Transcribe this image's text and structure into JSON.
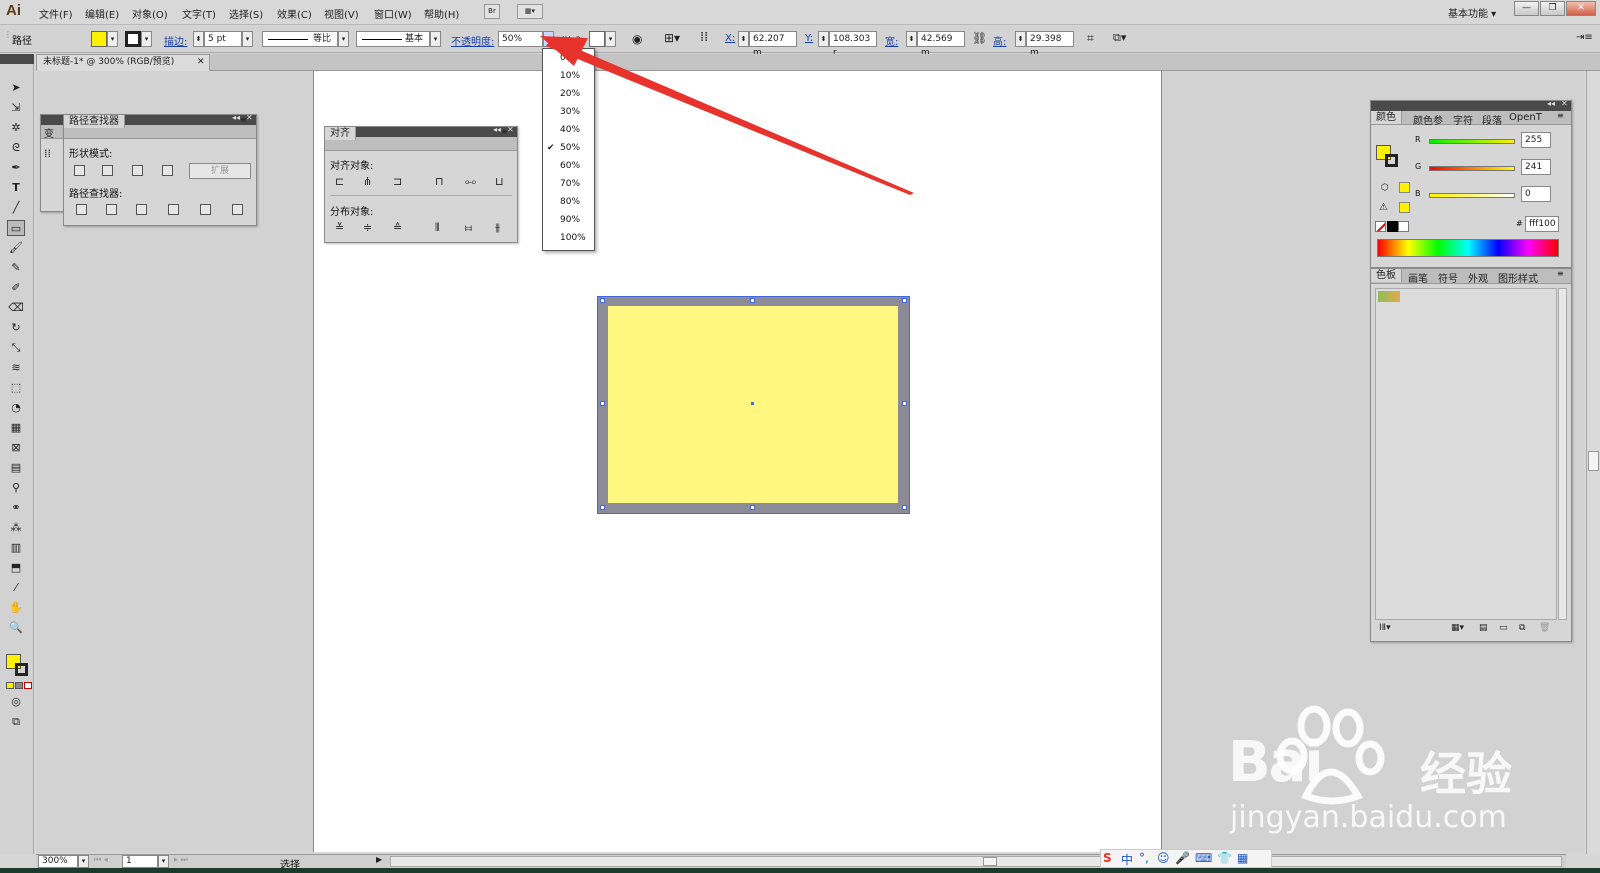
{
  "app": {
    "logo": "Ai"
  },
  "menu": [
    "文件(F)",
    "编辑(E)",
    "对象(O)",
    "文字(T)",
    "选择(S)",
    "效果(C)",
    "视图(V)",
    "窗口(W)",
    "帮助(H)"
  ],
  "menubar_buttons": [
    "Br",
    "▦▾"
  ],
  "workspace": "基本功能",
  "window_controls": [
    "—",
    "❐",
    "✕"
  ],
  "control": {
    "object_type": "路径",
    "stroke_label": "描边:",
    "stroke_value": "5 pt",
    "profile_label": "等比",
    "brush_label": "基本",
    "opacity_label": "不透明度:",
    "opacity_value": "50%",
    "style_label": "样式:",
    "x_label": "X:",
    "x_value": "62.207 m",
    "y_label": "Y:",
    "y_value": "108.303 r",
    "w_label": "宽:",
    "w_value": "42.569 m",
    "h_label": "高:",
    "h_value": "29.398 m"
  },
  "document_tab": "未标题-1* @ 300% (RGB/预览)",
  "opacity_options": [
    "0%",
    "10%",
    "20%",
    "30%",
    "40%",
    "50%",
    "60%",
    "70%",
    "80%",
    "90%",
    "100%"
  ],
  "opacity_selected_index": 5,
  "pathfinder": {
    "title": "路径查找器",
    "side_tab": "变",
    "shape_modes": "形状模式:",
    "expand": "扩展",
    "pathfinders": "路径查找器:"
  },
  "align": {
    "title": "对齐",
    "align_objects": "对齐对象:",
    "distribute_objects": "分布对象:"
  },
  "color_panel": {
    "tabs": [
      "颜色",
      "颜色参",
      "字符",
      "段落",
      "OpenT"
    ],
    "r_label": "R",
    "r_value": "255",
    "g_label": "G",
    "g_value": "241",
    "b_label": "B",
    "b_value": "0",
    "hex_label": "#",
    "hex_value": "fff100"
  },
  "swatch_panel": {
    "tabs": [
      "色板",
      "画笔",
      "符号",
      "外观",
      "图形样式"
    ]
  },
  "status": {
    "zoom": "300%",
    "page": "1",
    "mode": "选择"
  },
  "watermark": {
    "brand": "Bai",
    "brand2": "经验",
    "url": "jingyan.baidu.com"
  },
  "ime": [
    "S",
    "中",
    "°,",
    "☺",
    "🎤",
    "⌨",
    "👕",
    "▦"
  ],
  "colors": {
    "fill": "#fff100",
    "rect_fill": "#fff780",
    "arrow": "#e8322c"
  }
}
